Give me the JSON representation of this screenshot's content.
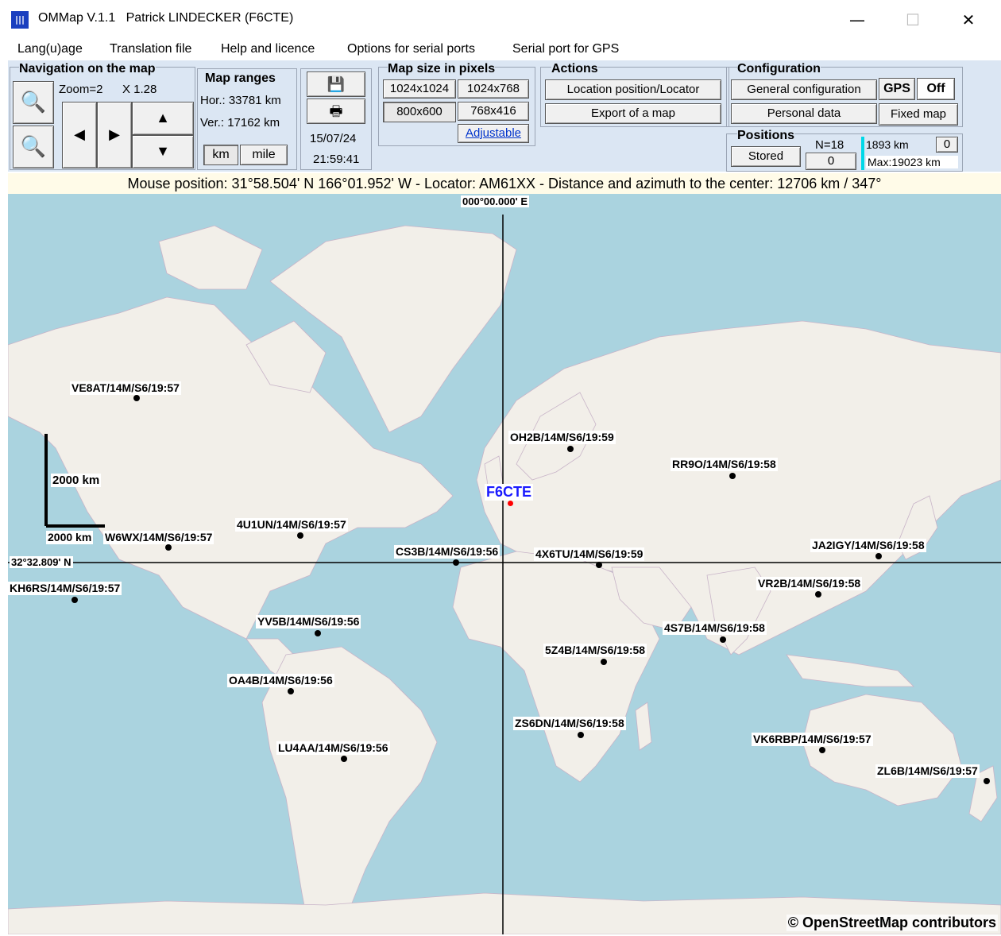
{
  "window": {
    "icon_text": "|||",
    "title": "OMMap V.1.1   Patrick LINDECKER (F6CTE)",
    "minimize": "—",
    "maximize": "☐",
    "close": "✕"
  },
  "menu": [
    "Lang(u)age",
    "Translation file",
    "Help and licence",
    "Options for serial ports",
    "Serial port for GPS"
  ],
  "navigation": {
    "title": "Navigation on the map",
    "zoom": "Zoom=2",
    "factor": "X 1.28",
    "zoom_in_icon": "🔍",
    "zoom_out_icon": "🔍",
    "left": "◀",
    "right": "▶",
    "up": "▲",
    "down": "▼"
  },
  "ranges": {
    "title": "Map ranges",
    "hor": "Hor.: 33781 km",
    "ver": "Ver.: 17162 km",
    "km": "km",
    "mile": "mile"
  },
  "file": {
    "save_icon": "💾",
    "print_icon": "🖶",
    "date": "15/07/24",
    "time": "21:59:41"
  },
  "mapsize": {
    "title": "Map size in pixels",
    "b1": "1024x1024",
    "b2": "1024x768",
    "b3": "800x600",
    "b4": "768x416",
    "adjustable": "Adjustable"
  },
  "actions": {
    "title": "Actions",
    "locator": "Location position/Locator",
    "export": "Export of a map"
  },
  "config": {
    "title": "Configuration",
    "general": "General configuration",
    "gps": "GPS",
    "off": "Off",
    "personal": "Personal data",
    "fixed": "Fixed map"
  },
  "positions": {
    "title": "Positions",
    "stored": "Stored",
    "n": "N=18",
    "zero": "0",
    "dist": "1893 km",
    "dist_zero": "0",
    "max": "Max:19023 km"
  },
  "status": "Mouse position: 31°58.504' N 166°01.952' W - Locator: AM61XX - Distance and azimuth to the center: 12706 km / 347°",
  "map": {
    "meridian_label": "000°00.000' E",
    "parallel_label": "32°32.809' N",
    "scale_v": "2000 km",
    "scale_h": "2000 km",
    "home": "F6CTE",
    "attribution": "© OpenStreetMap contributors",
    "colors": {
      "sea": "#aad3df",
      "land": "#f2efe9",
      "border": "#c8a8c8",
      "home": "#1a1aff"
    },
    "stations": [
      {
        "call": "VE8AT/14M/S6/19:57"
      },
      {
        "call": "OH2B/14M/S6/19:59"
      },
      {
        "call": "RR9O/14M/S6/19:58"
      },
      {
        "call": "4U1UN/14M/S6/19:57"
      },
      {
        "call": "W6WX/14M/S6/19:57"
      },
      {
        "call": "CS3B/14M/S6/19:56"
      },
      {
        "call": "4X6TU/14M/S6/19:59"
      },
      {
        "call": "JA2IGY/14M/S6/19:58"
      },
      {
        "call": "KH6RS/14M/S6/19:57"
      },
      {
        "call": "VR2B/14M/S6/19:58"
      },
      {
        "call": "YV5B/14M/S6/19:56"
      },
      {
        "call": "4S7B/14M/S6/19:58"
      },
      {
        "call": "5Z4B/14M/S6/19:58"
      },
      {
        "call": "OA4B/14M/S6/19:56"
      },
      {
        "call": "ZS6DN/14M/S6/19:58"
      },
      {
        "call": "VK6RBP/14M/S6/19:57"
      },
      {
        "call": "LU4AA/14M/S6/19:56"
      },
      {
        "call": "ZL6B/14M/S6/19:57"
      }
    ]
  }
}
